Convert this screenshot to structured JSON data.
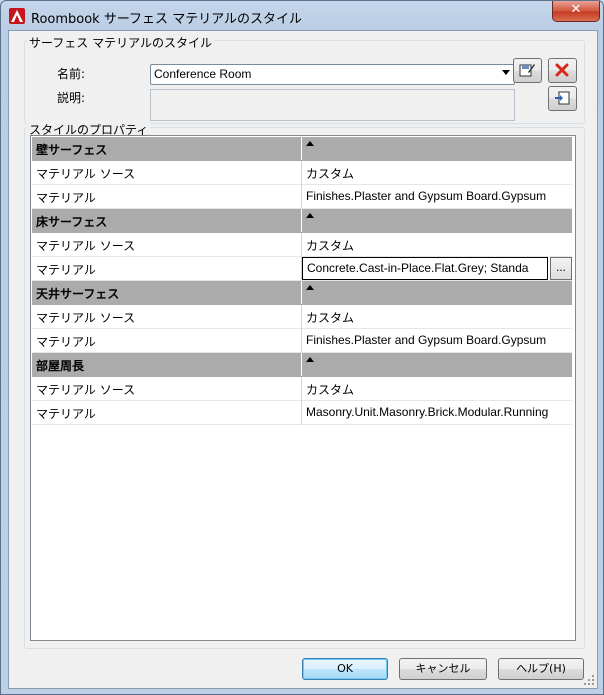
{
  "window": {
    "title": "Roombook サーフェス マテリアルのスタイル",
    "close_symbol": "✕"
  },
  "surface_group": {
    "legend": "サーフェス マテリアルのスタイル",
    "name_label": "名前:",
    "name_value": "Conference Room",
    "description_label": "説明:",
    "description_value": ""
  },
  "properties": {
    "legend": "スタイルのプロパティ",
    "categories": [
      {
        "title": "壁サーフェス",
        "rows": [
          {
            "name": "マテリアル ソース",
            "value": "カスタム"
          },
          {
            "name": "マテリアル",
            "value": "Finishes.Plaster and Gypsum Board.Gypsum"
          }
        ]
      },
      {
        "title": "床サーフェス",
        "rows": [
          {
            "name": "マテリアル ソース",
            "value": "カスタム"
          },
          {
            "name": "マテリアル",
            "value": "Concrete.Cast-in-Place.Flat.Grey; Standa",
            "browse_label": "..."
          }
        ]
      },
      {
        "title": "天井サーフェス",
        "rows": [
          {
            "name": "マテリアル ソース",
            "value": "カスタム"
          },
          {
            "name": "マテリアル",
            "value": "Finishes.Plaster and Gypsum Board.Gypsum"
          }
        ]
      },
      {
        "title": "部屋周長",
        "rows": [
          {
            "name": "マテリアル ソース",
            "value": "カスタム"
          },
          {
            "name": "マテリアル",
            "value": "Masonry.Unit.Masonry.Brick.Modular.Running"
          }
        ]
      }
    ]
  },
  "buttons": {
    "ok": "OK",
    "cancel": "キャンセル",
    "help": "ヘルプ(H)"
  },
  "icons": {
    "app": "autocad-logo-icon",
    "edit_style": "edit-style-icon",
    "delete_style": "delete-icon",
    "import_style": "import-style-icon"
  }
}
